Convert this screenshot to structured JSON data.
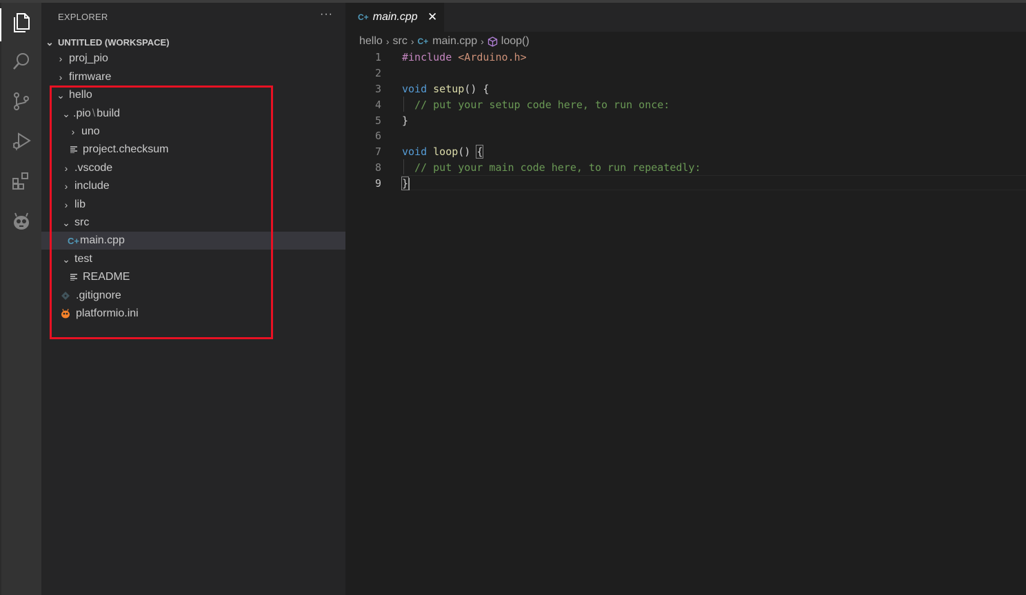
{
  "colors": {
    "accent_red_box": "#e81123",
    "selected_row": "#37373d",
    "cpp_icon": "#519aba",
    "platformio_icon": "#f5822a"
  },
  "activity_bar": {
    "items": [
      {
        "name": "explorer-icon"
      },
      {
        "name": "search-icon"
      },
      {
        "name": "source-control-icon"
      },
      {
        "name": "run-debug-icon"
      },
      {
        "name": "extensions-icon"
      },
      {
        "name": "platformio-icon"
      }
    ]
  },
  "sidebar": {
    "header": "EXPLORER",
    "more": "···",
    "workspace": "UNTITLED (WORKSPACE)",
    "tree": [
      {
        "label": "proj_pio",
        "icon": "chevron-right"
      },
      {
        "label": "firmware",
        "icon": "chevron-right"
      },
      {
        "label": "hello",
        "icon": "chevron-down"
      },
      {
        "label_a": ".pio",
        "sep": "\\",
        "label_b": "build",
        "icon": "chevron-down"
      },
      {
        "label": "uno",
        "icon": "chevron-right"
      },
      {
        "label": "project.checksum",
        "icon": "text-file"
      },
      {
        "label": ".vscode",
        "icon": "chevron-right"
      },
      {
        "label": "include",
        "icon": "chevron-right"
      },
      {
        "label": "lib",
        "icon": "chevron-right"
      },
      {
        "label": "src",
        "icon": "chevron-down"
      },
      {
        "label": "main.cpp",
        "icon": "cpp-file"
      },
      {
        "label": "test",
        "icon": "chevron-down"
      },
      {
        "label": "README",
        "icon": "text-file"
      },
      {
        "label": ".gitignore",
        "icon": "git-file"
      },
      {
        "label": "platformio.ini",
        "icon": "platformio-file"
      }
    ]
  },
  "tabs": [
    {
      "label": "main.cpp",
      "close": "✕"
    }
  ],
  "breadcrumb": [
    "hello",
    "src",
    "main.cpp",
    "loop()"
  ],
  "editor": {
    "line_numbers": [
      "1",
      "2",
      "3",
      "4",
      "5",
      "6",
      "7",
      "8",
      "9"
    ],
    "lines": {
      "l1_directive": "#include",
      "l1_header": "<Arduino.h>",
      "l3_kw": "void",
      "l3_fn": "setup",
      "l3_rest": "() {",
      "l4_comment": "// put your setup code here, to run once:",
      "l5": "}",
      "l7_kw": "void",
      "l7_fn": "loop",
      "l7_rest": "() ",
      "l7_brace": "{",
      "l8_comment": "// put your main code here, to run repeatedly:",
      "l9": "}"
    }
  }
}
